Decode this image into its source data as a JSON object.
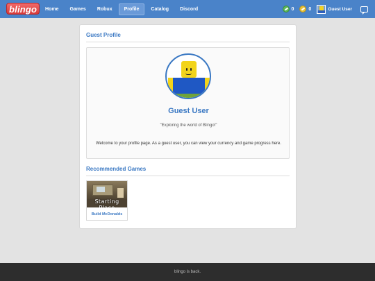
{
  "header": {
    "logo": "blingo",
    "nav": [
      {
        "label": "Home",
        "active": false
      },
      {
        "label": "Games",
        "active": false
      },
      {
        "label": "Robux",
        "active": false
      },
      {
        "label": "Profile",
        "active": true
      },
      {
        "label": "Catalog",
        "active": false
      },
      {
        "label": "Discord",
        "active": false
      }
    ],
    "currency_green": "0",
    "currency_gold": "0",
    "username": "Guest User",
    "colors": {
      "bar": "#4a83c9",
      "logo": "#e04848"
    }
  },
  "profile": {
    "section_title": "Guest Profile",
    "display_name": "Guest User",
    "tagline": "\"Exploring the world of Blingo!\"",
    "welcome": "Welcome to your profile page. As a guest user, you can view your currency and game progress here."
  },
  "recommended": {
    "section_title": "Recommended Games",
    "games": [
      {
        "thumb_caption": "Starting Place",
        "name": "Build McDonalds"
      }
    ]
  },
  "footer": {
    "text": "blingo is back."
  }
}
